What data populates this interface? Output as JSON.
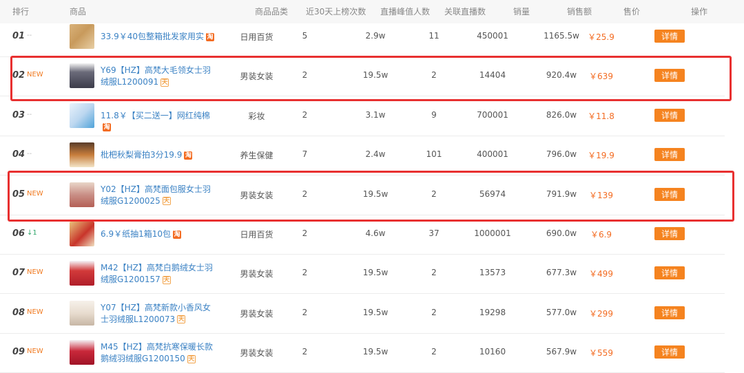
{
  "header": {
    "rank": "排行",
    "product": "商品",
    "category": "商品品类",
    "times_30d": "近30天上榜次数",
    "peak_viewers": "直播峰值人数",
    "related_live": "关联直播数",
    "sales": "销量",
    "sales_amount": "销售额",
    "price": "售价",
    "action": "操作"
  },
  "detail_label": "详情",
  "badges": {
    "taobao": "淘",
    "tmall": "天"
  },
  "rows": [
    {
      "rank": "01",
      "trend": "--",
      "name": "33.9￥40包整箱批发家用实",
      "badge": "taobao",
      "category": "日用百货",
      "times": "5",
      "peak": "2.9w",
      "live": "11",
      "sales": "450001",
      "amount": "1165.5w",
      "price": "￥25.9"
    },
    {
      "rank": "02",
      "trend": "NEW",
      "name": "Y69【HZ】高梵大毛领女士羽绒服L1200091",
      "badge": "tmall",
      "category": "男装女装",
      "times": "2",
      "peak": "19.5w",
      "live": "2",
      "sales": "14404",
      "amount": "920.4w",
      "price": "￥639"
    },
    {
      "rank": "03",
      "trend": "--",
      "name": "11.8￥【买二送一】网红纯棉",
      "badge": "taobao",
      "category": "彩妆",
      "times": "2",
      "peak": "3.1w",
      "live": "9",
      "sales": "700001",
      "amount": "826.0w",
      "price": "￥11.8"
    },
    {
      "rank": "04",
      "trend": "--",
      "name": "枇杷秋梨膏拍3分19.9",
      "badge": "taobao",
      "category": "养生保健",
      "times": "7",
      "peak": "2.4w",
      "live": "101",
      "sales": "400001",
      "amount": "796.0w",
      "price": "￥19.9"
    },
    {
      "rank": "05",
      "trend": "NEW",
      "name": "Y02【HZ】高梵面包服女士羽绒服G1200025",
      "badge": "tmall",
      "category": "男装女装",
      "times": "2",
      "peak": "19.5w",
      "live": "2",
      "sales": "56974",
      "amount": "791.9w",
      "price": "￥139"
    },
    {
      "rank": "06",
      "trend": "↓1",
      "name": "6.9￥纸抽1箱10包",
      "badge": "taobao",
      "category": "日用百货",
      "times": "2",
      "peak": "4.6w",
      "live": "37",
      "sales": "1000001",
      "amount": "690.0w",
      "price": "￥6.9"
    },
    {
      "rank": "07",
      "trend": "NEW",
      "name": "M42【HZ】高梵白鹅绒女士羽绒服G1200157",
      "badge": "tmall",
      "category": "男装女装",
      "times": "2",
      "peak": "19.5w",
      "live": "2",
      "sales": "13573",
      "amount": "677.3w",
      "price": "￥499"
    },
    {
      "rank": "08",
      "trend": "NEW",
      "name": "Y07【HZ】高梵新款小香风女士羽绒服L1200073",
      "badge": "tmall",
      "category": "男装女装",
      "times": "2",
      "peak": "19.5w",
      "live": "2",
      "sales": "19298",
      "amount": "577.0w",
      "price": "￥299"
    },
    {
      "rank": "09",
      "trend": "NEW",
      "name": "M45【HZ】高梵抗寒保暖长款鹅绒羽绒服G1200150",
      "badge": "tmall",
      "category": "男装女装",
      "times": "2",
      "peak": "19.5w",
      "live": "2",
      "sales": "10160",
      "amount": "567.9w",
      "price": "￥559"
    }
  ]
}
